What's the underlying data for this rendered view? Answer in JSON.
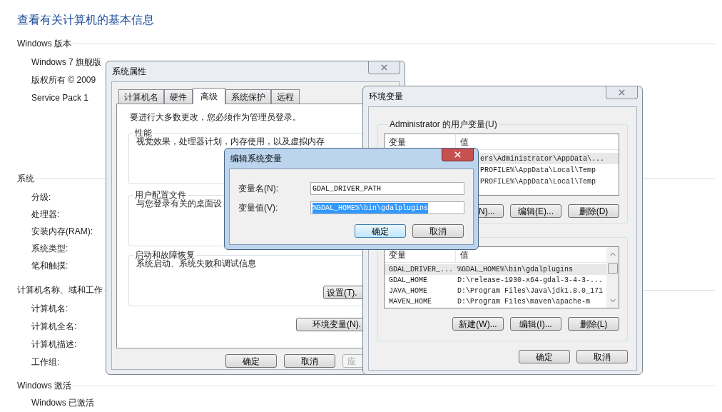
{
  "page": {
    "title": "查看有关计算机的基本信息",
    "sections": [
      {
        "heading": "Windows 版本",
        "items": [
          "Windows 7 旗舰版",
          "版权所有 © 2009",
          "Service Pack 1"
        ]
      },
      {
        "heading": "系统",
        "items": [
          "分级:",
          "处理器:",
          "安装内存(RAM):",
          "系统类型:",
          "笔和触摸:"
        ]
      },
      {
        "heading": "计算机名称、域和工作",
        "items": [
          "计算机名:",
          "计算机全名:",
          "计算机描述:",
          "工作组:"
        ]
      },
      {
        "heading": "Windows 激活",
        "items": [
          "Windows 已激活"
        ]
      }
    ]
  },
  "system_properties": {
    "title": "系统属性",
    "active": false,
    "tabs": [
      {
        "label": "计算机名",
        "selected": false
      },
      {
        "label": "硬件",
        "selected": false
      },
      {
        "label": "高级",
        "selected": true
      },
      {
        "label": "系统保护",
        "selected": false
      },
      {
        "label": "远程",
        "selected": false
      }
    ],
    "notice": "要进行大多数更改，您必须作为管理员登录。",
    "groups": [
      {
        "title": "性能",
        "text": "视觉效果，处理器计划，内存使用，以及虚拟内存"
      },
      {
        "title": "用户配置文件",
        "text": "与您登录有关的桌面设"
      },
      {
        "title": "启动和故障恢复",
        "text": "系统启动、系统失败和调试信息",
        "button": "设置(T)."
      }
    ],
    "env_button": "环境变量(N).",
    "buttons": [
      {
        "label": "确定",
        "disabled": false
      },
      {
        "label": "取消",
        "disabled": false
      },
      {
        "label": "应",
        "disabled": true
      }
    ]
  },
  "environment_variables": {
    "title": "环境变量",
    "active": false,
    "user_variables": {
      "title": "Administrator 的用户变量(U)",
      "columns": [
        "变量",
        "值"
      ],
      "rows": [
        {
          "value": "ers\\Administrator\\AppData\\...",
          "selected": true
        },
        {
          "value": "PROFILE%\\AppData\\Local\\Temp",
          "selected": false
        },
        {
          "value": "PROFILE%\\AppData\\Local\\Temp",
          "selected": false
        }
      ],
      "buttons": [
        "N)...",
        "编辑(E)...",
        "删除(D)"
      ]
    },
    "system_variables": {
      "columns": [
        "变量",
        "值"
      ],
      "rows": [
        {
          "name": "GDAL_DRIVER_...",
          "value": "%GDAL_HOME%\\bin\\gdalplugins",
          "selected": true
        },
        {
          "name": "GDAL_HOME",
          "value": "D:\\release-1930-x64-gdal-3-4-3-...",
          "selected": false
        },
        {
          "name": "JAVA_HOME",
          "value": "D:\\Program Files\\Java\\jdk1.8.0_171",
          "selected": false
        },
        {
          "name": "MAVEN_HOME",
          "value": "D:\\Program Files\\maven\\apache-m",
          "selected": false
        }
      ],
      "buttons": [
        "新建(W)...",
        "编辑(I)...",
        "删除(L)"
      ]
    },
    "buttons": [
      "确定",
      "取消"
    ]
  },
  "edit_dialog": {
    "title": "编辑系统变量",
    "active": true,
    "fields": [
      {
        "label": "变量名(N):",
        "value": "GDAL_DRIVER_PATH",
        "selected": false
      },
      {
        "label": "变量值(V):",
        "value": "%GDAL_HOME%\\bin\\gdalplugins",
        "selected": true
      }
    ],
    "buttons": [
      {
        "label": "确定",
        "focused": true
      },
      {
        "label": "取消",
        "focused": false
      }
    ]
  }
}
